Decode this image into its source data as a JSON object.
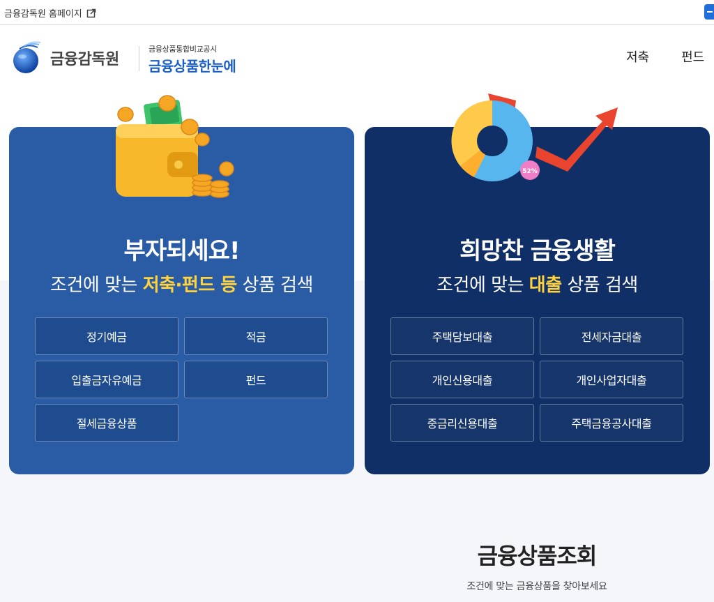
{
  "topbar": {
    "fss_home_link": "금융감독원 홈페이지",
    "external_icon": "external-link-icon"
  },
  "header": {
    "fss_logo_text": "금융감독원",
    "service_sub": "금융상품통합비교공시",
    "service_main": "금융상품한눈에",
    "nav": [
      "저축",
      "펀드"
    ]
  },
  "savings_card": {
    "title": "부자되세요!",
    "sub_pre": "조건에 맞는 ",
    "sub_highlight": "저축·펀드 등",
    "sub_post": " 상품 검색",
    "buttons": [
      "정기예금",
      "적금",
      "입출금자유예금",
      "펀드",
      "절세금융상품"
    ],
    "bg_color": "#2a5ca6",
    "highlight_color": "#ffd23f"
  },
  "loan_card": {
    "title": "희망찬 금융생활",
    "sub_pre": "조건에 맞는 ",
    "sub_highlight": "대출",
    "sub_post": " 상품 검색",
    "buttons": [
      "주택담보대출",
      "전세자금대출",
      "개인신용대출",
      "개인사업자대출",
      "중금리신용대출",
      "주택금융공사대출"
    ],
    "chart_badge": "52%",
    "bg_color": "#0f2f66"
  },
  "search_section": {
    "title": "금융상품조회",
    "subtitle": "조건에 맞는 금융상품을 찾아보세요"
  }
}
